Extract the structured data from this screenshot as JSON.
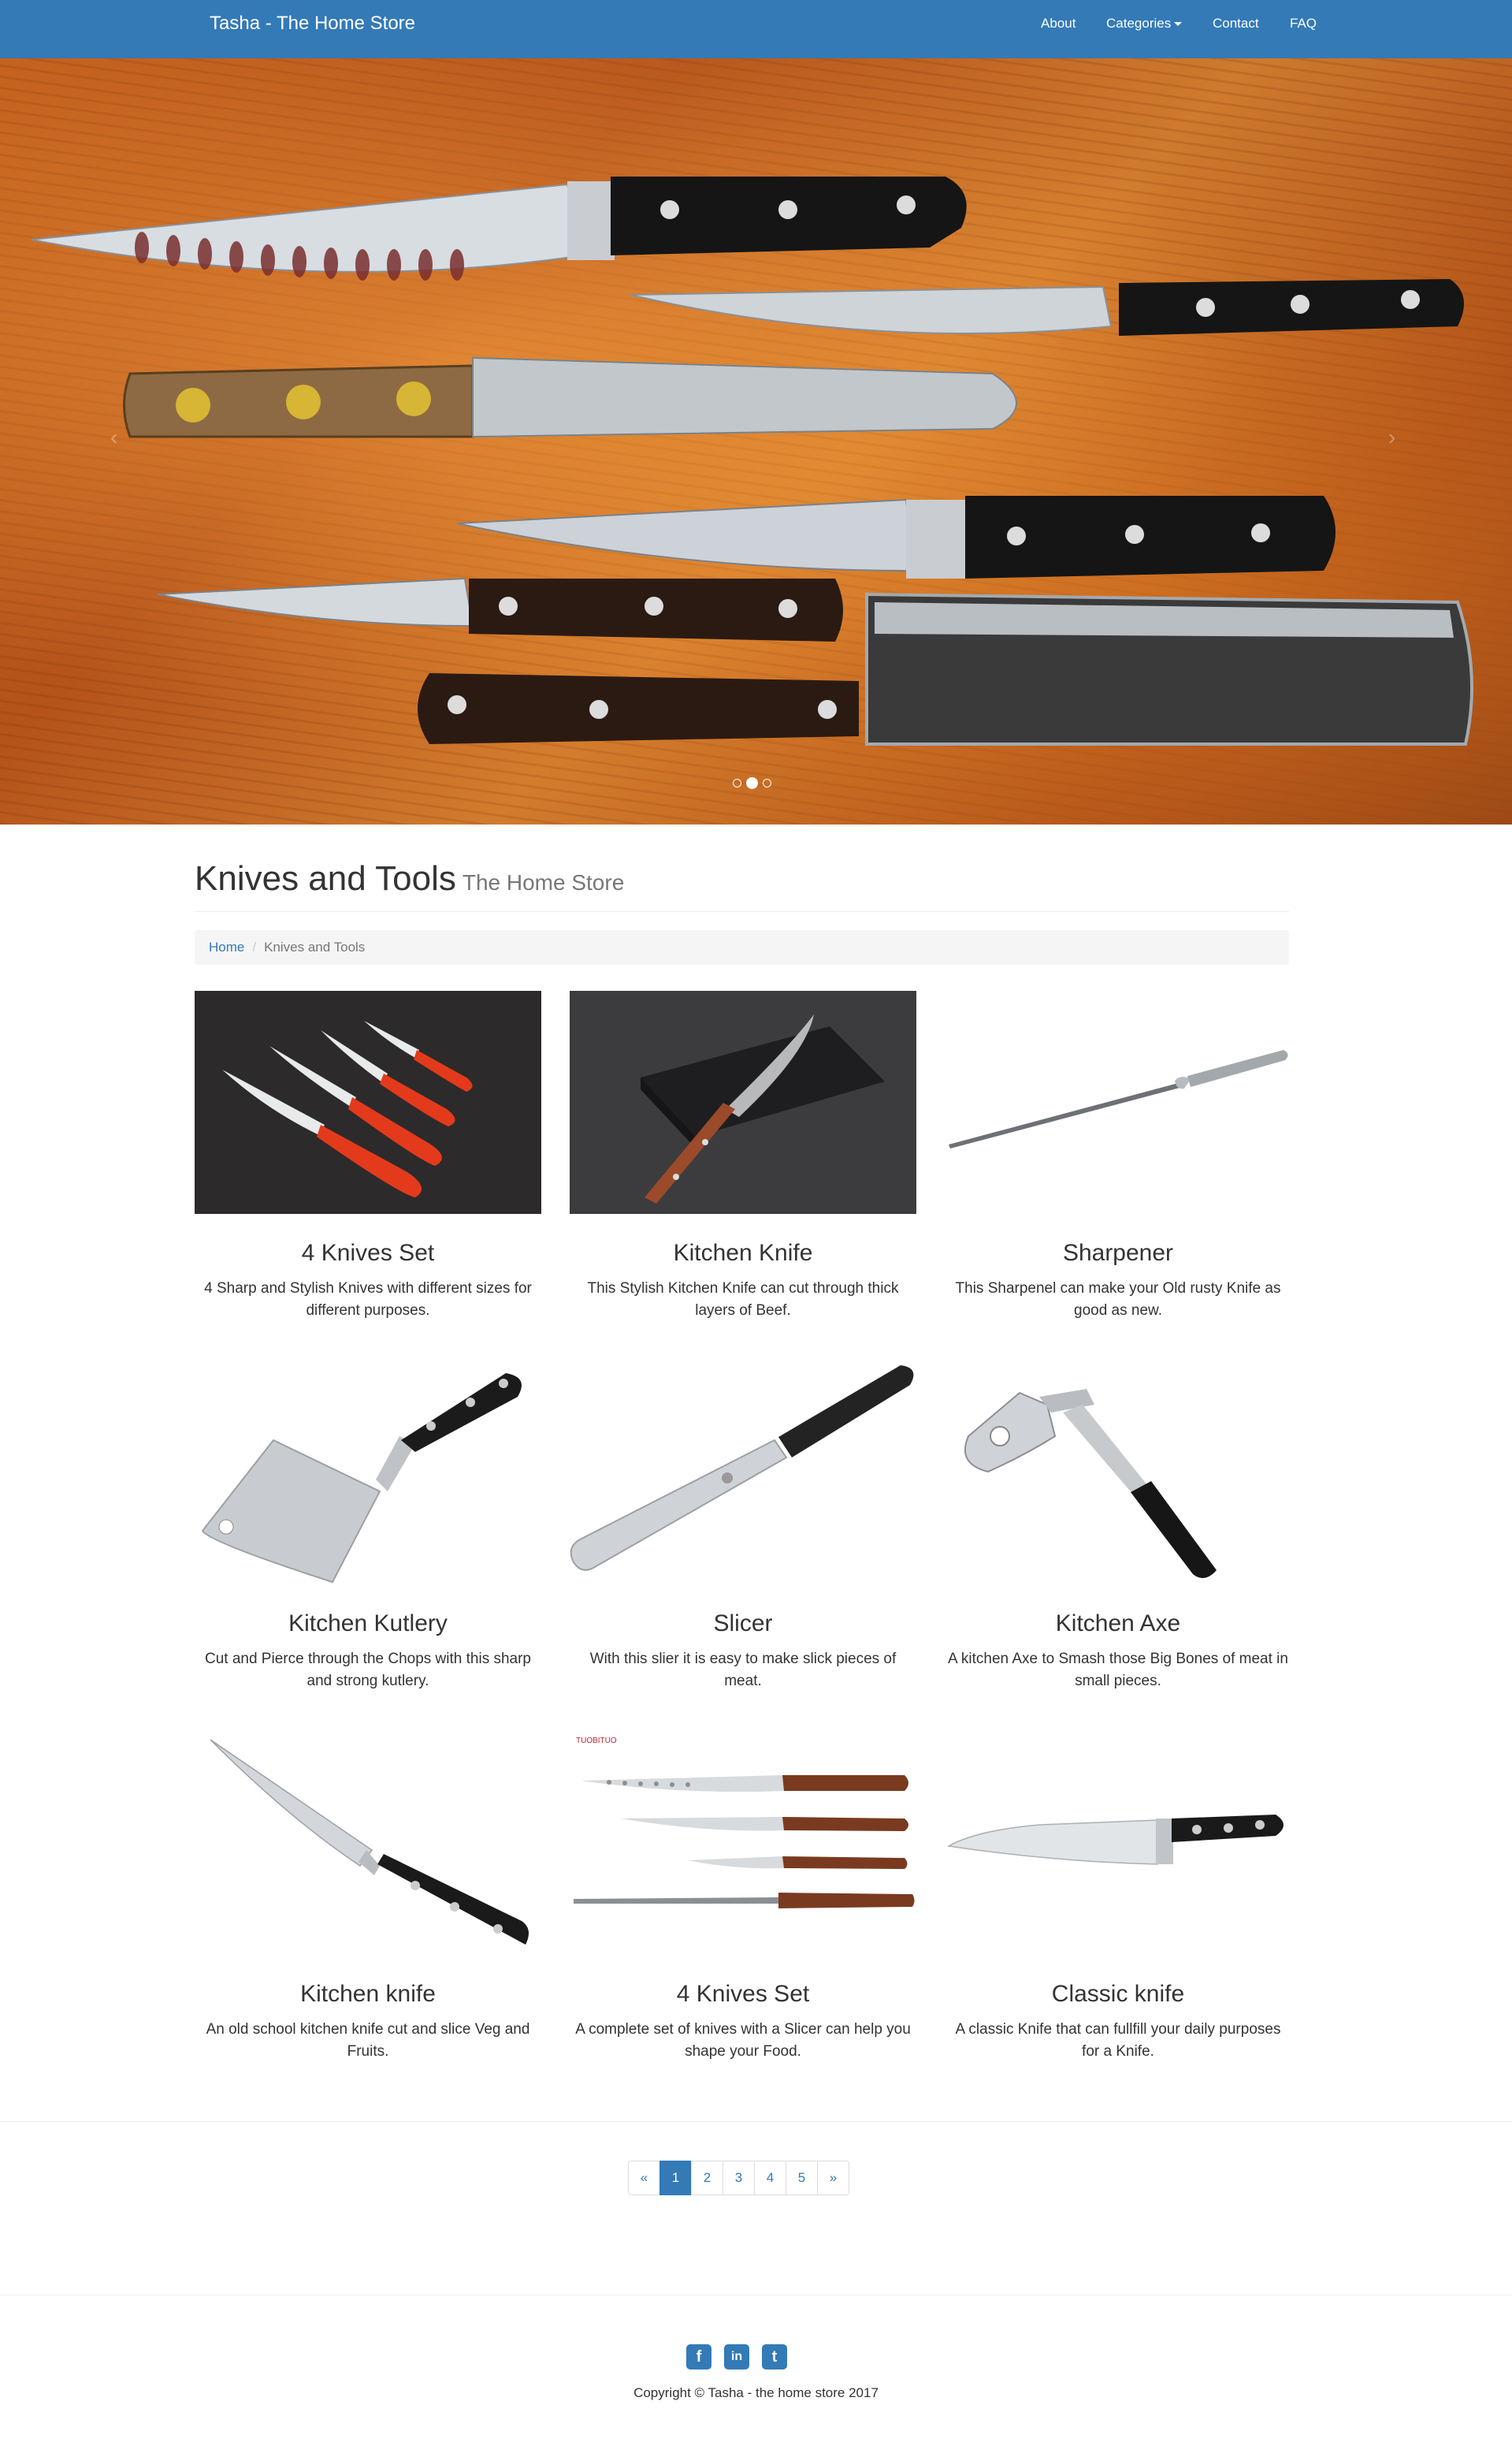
{
  "navbar": {
    "brand": "Tasha - The Home Store",
    "links": [
      "About",
      "Categories",
      "Contact",
      "FAQ"
    ]
  },
  "carousel": {
    "slide_count": 3,
    "active_index": 1,
    "prev_icon": "‹",
    "next_icon": "›"
  },
  "header": {
    "title": "Knives and Tools",
    "subtitle": "The Home Store"
  },
  "breadcrumb": {
    "home": "Home",
    "current": "Knives and Tools"
  },
  "products": [
    {
      "title": "4 Knives Set",
      "description": "4 Sharp and Stylish Knives with different sizes for different purposes."
    },
    {
      "title": "Kitchen Knife",
      "description": "This Stylish Kitchen Knife can cut through thick layers of Beef."
    },
    {
      "title": "Sharpener",
      "description": "This Sharpenel can make your Old rusty Knife as good as new."
    },
    {
      "title": "Kitchen Kutlery",
      "description": "Cut and Pierce through the Chops with this sharp and strong kutlery."
    },
    {
      "title": "Slicer",
      "description": "With this slier it is easy to make slick pieces of meat."
    },
    {
      "title": "Kitchen Axe",
      "description": "A kitchen Axe to Smash those Big Bones of meat in small pieces."
    },
    {
      "title": "Kitchen knife",
      "description": "An old school kitchen knife cut and slice Veg and Fruits."
    },
    {
      "title": "4 Knives Set",
      "description": "A complete set of knives with a Slicer can help you shape your Food."
    },
    {
      "title": "Classic knife",
      "description": "A classic Knife that can fullfill your daily purposes for a Knife."
    }
  ],
  "product_images": {
    "brand_mark": "TUOBITUO"
  },
  "pagination": {
    "prev": "«",
    "pages": [
      "1",
      "2",
      "3",
      "4",
      "5"
    ],
    "next": "»",
    "active": "1"
  },
  "footer": {
    "social": [
      "f",
      "in",
      "t"
    ],
    "copyright": "Copyright © Tasha - the home store 2017"
  },
  "colors": {
    "primary": "#337ab7",
    "text": "#333333",
    "muted": "#777777"
  }
}
